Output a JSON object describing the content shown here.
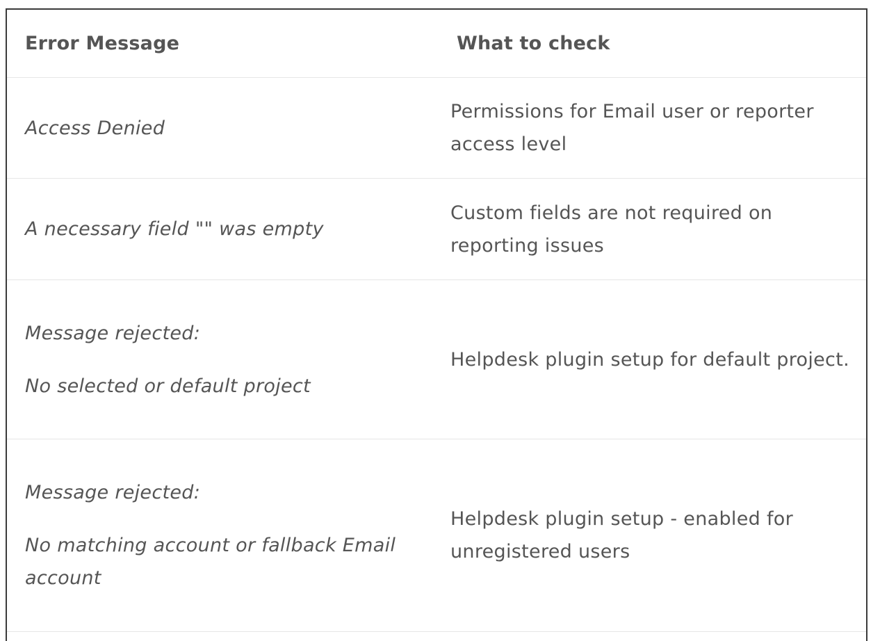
{
  "table": {
    "headers": {
      "error_message": "Error Message",
      "what_to_check": "What to check"
    },
    "rows": [
      {
        "error_lines": [
          "Access Denied"
        ],
        "check": "Permissions for Email user or reporter access level"
      },
      {
        "error_lines": [
          "A necessary field \"\" was empty"
        ],
        "check": "Custom fields are not required on reporting issues"
      },
      {
        "error_lines": [
          "Message rejected:",
          "No selected or default project"
        ],
        "check": "Helpdesk plugin setup for default project."
      },
      {
        "error_lines": [
          "Message rejected:",
          "No matching account or fallback Email account"
        ],
        "check": "Helpdesk plugin setup - enabled for unregistered users"
      }
    ]
  }
}
